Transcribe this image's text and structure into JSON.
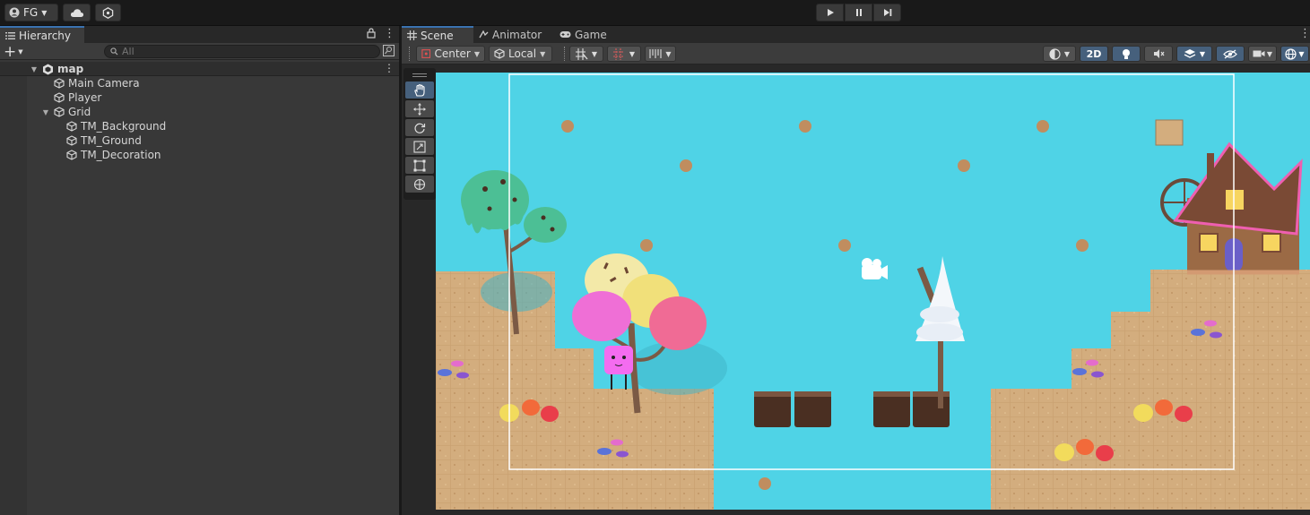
{
  "topbar": {
    "account_label": "FG",
    "account_icon": "user-circle-icon",
    "cloud_icon": "cloud-icon",
    "services_icon": "hexagon-icon",
    "play_controls": [
      "play-icon",
      "pause-icon",
      "step-icon"
    ]
  },
  "hierarchy": {
    "tab_label": "Hierarchy",
    "add_button": "+",
    "search_placeholder": "All",
    "scene_name": "map",
    "items": [
      {
        "label": "Main Camera",
        "depth": 1,
        "expandable": false
      },
      {
        "label": "Player",
        "depth": 1,
        "expandable": false
      },
      {
        "label": "Grid",
        "depth": 1,
        "expandable": true
      },
      {
        "label": "TM_Background",
        "depth": 2,
        "expandable": false
      },
      {
        "label": "TM_Ground",
        "depth": 2,
        "expandable": false
      },
      {
        "label": "TM_Decoration",
        "depth": 2,
        "expandable": false
      }
    ]
  },
  "scene": {
    "tabs": [
      {
        "label": "Scene",
        "icon": "grid-icon",
        "active": true
      },
      {
        "label": "Animator",
        "icon": "animator-icon",
        "active": false
      },
      {
        "label": "Game",
        "icon": "gamepad-icon",
        "active": false
      }
    ],
    "toolbar": {
      "pivot_mode": "Center",
      "pivot_space": "Local",
      "mode_2d": "2D"
    },
    "colors": {
      "sky": "#4fd3e6",
      "ground": "#d3ad7e",
      "accent": "#46607c"
    },
    "tools": [
      "hand-icon",
      "move-icon",
      "rotate-icon",
      "scale-icon",
      "rect-icon",
      "transform-icon"
    ]
  }
}
